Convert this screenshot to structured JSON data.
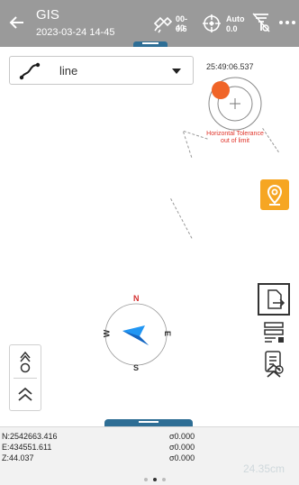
{
  "header": {
    "title": "GIS",
    "datetime": "2023-03-24 14-45",
    "satellite": {
      "top": "00-40",
      "bottom": "0.6"
    },
    "fix": {
      "top": "Auto",
      "bottom": "0.0"
    }
  },
  "map": {
    "layer_select": {
      "value": "line"
    },
    "time": "25:49:06.537",
    "tolerance_warning": "Horizontal Tolerance out of limit",
    "compass": {
      "n": "N",
      "s": "S",
      "w": "W",
      "e": "E"
    },
    "accent_color": "#f6a623",
    "alert_color": "#e0342a"
  },
  "coords": {
    "n": "N:2542663.416",
    "e": "E:434551.611",
    "z": "Z:44.037",
    "sigma_n": "σ0.000",
    "sigma_e": "σ0.000",
    "sigma_z": "σ0.000",
    "scale": "24.35cm"
  },
  "icons": [
    "back-arrow-icon",
    "satellite-icon",
    "crosshair-icon",
    "antenna-icon",
    "more-icon",
    "polyline-icon",
    "location-pin-icon",
    "export-icon",
    "list-icon",
    "report-icon",
    "chevron-up-icon",
    "rover-station-icon"
  ]
}
